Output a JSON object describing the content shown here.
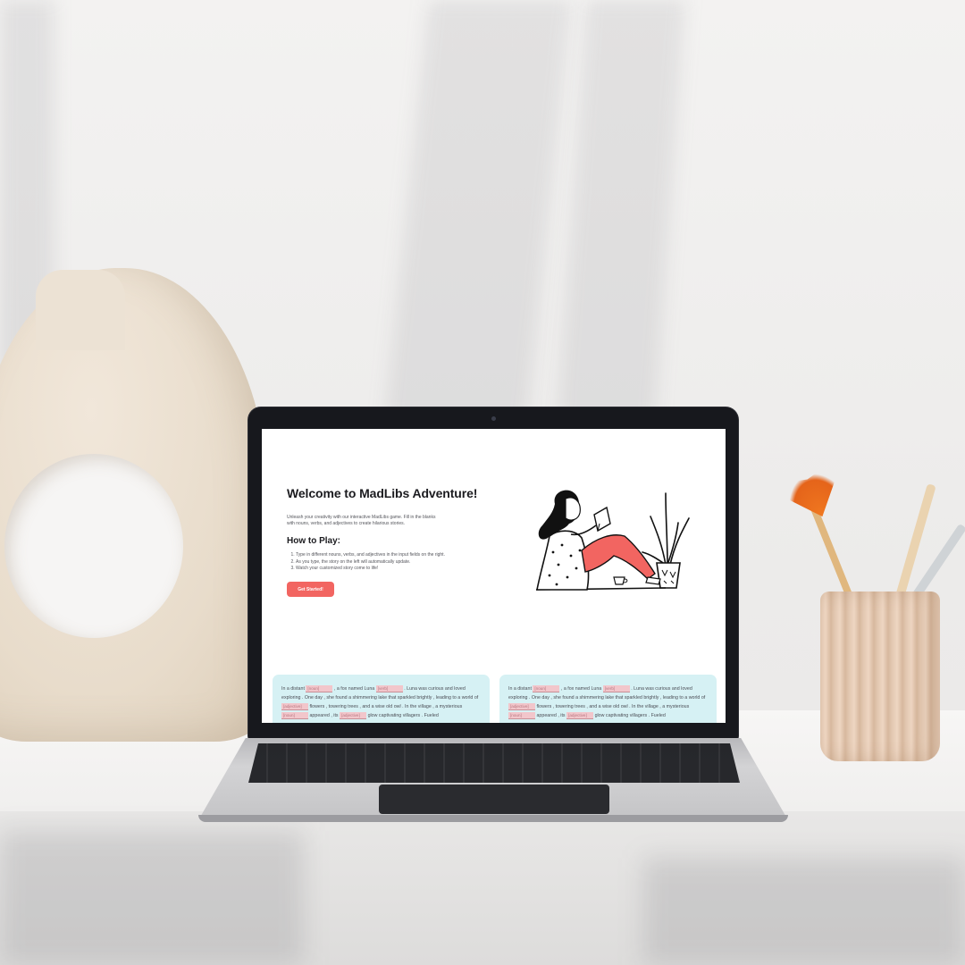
{
  "hero": {
    "title": "Welcome to MadLibs Adventure!",
    "description": "Unleash your creativity with our interactive MadLibs game. Fill in the blanks with nouns, verbs, and adjectives to create hilarious stories.",
    "howto_title": "How to Play:",
    "steps": [
      "Type in different nouns, verbs, and adjectives in the input fields on the right.",
      "As you type, the story on the left will automatically update.",
      "Watch your customized story come to life!"
    ],
    "cta_label": "Get Started!"
  },
  "illustration": {
    "icon": "woman-reading-with-plant-illustration",
    "accent_color": "#f26561"
  },
  "story_left": {
    "t1": "In a distant",
    "b1": "[noun]",
    "t2": ", a fox named Luna",
    "b2": "[verb]",
    "t3": ". Luna was curious and loved exploring . One day , she found a shimmering lake that sparkled brightly , leading to a world of",
    "b3": "[adjective]",
    "t4": "flowers , towering trees , and a wise old owl . In the village , a mysterious",
    "b4": "[noun]",
    "t5": "appeared , its",
    "b5": "[adjective]",
    "t6": "glow captivating villagers . Fueled"
  },
  "story_right": {
    "t1": "In a distant",
    "b1": "[noun]",
    "t2": ", a fox named Luna",
    "b2": "[verb]",
    "t3": ". Luna was curious and loved exploring . One day , she found a shimmering lake that sparkled brightly , leading to a world of",
    "b3": "[adjective]",
    "t4": "flowers , towering trees , and a wise old owl . In the village , a mysterious",
    "b4": "[noun]",
    "t5": "appeared , its",
    "b5": "[adjective]",
    "t6": "glow captivating villagers . Fueled"
  },
  "colors": {
    "cta": "#f26561",
    "card_bg": "#d6f1f4",
    "blank_bg": "#f2c6cb"
  }
}
